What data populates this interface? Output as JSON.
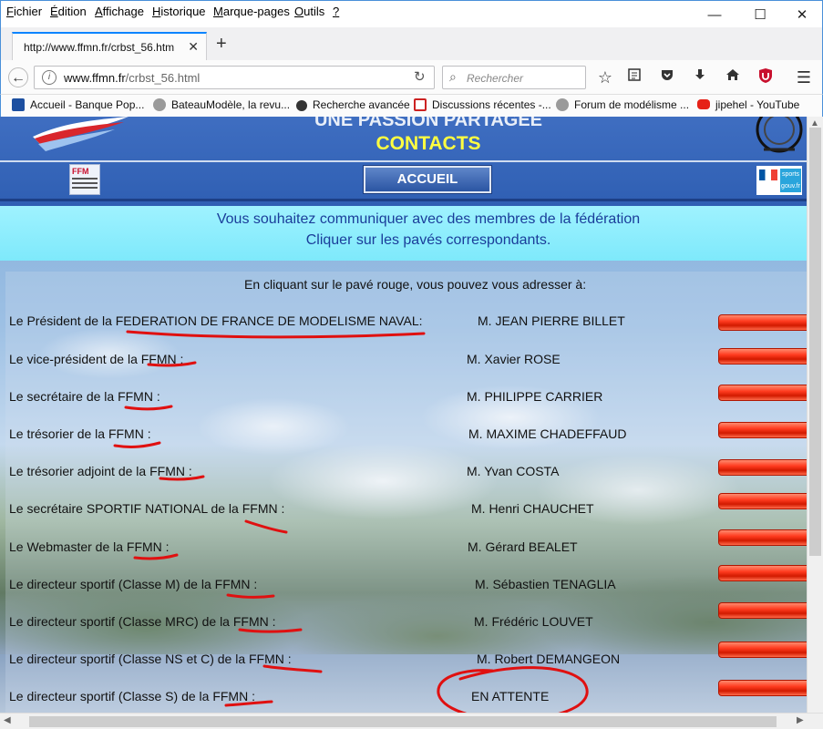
{
  "menubar": {
    "items": [
      "Fichier",
      "Édition",
      "Affichage",
      "Historique",
      "Marque-pages",
      "Outils",
      "?"
    ],
    "underlined": [
      "F",
      "É",
      "A",
      "H",
      "M",
      "O",
      "?"
    ],
    "rest": [
      "ichier",
      "dition",
      "ffichage",
      "istorique",
      "arque-pages",
      "utils",
      ""
    ]
  },
  "window_controls": {
    "minimize": "—",
    "maximize": "☐",
    "close": "✕"
  },
  "tab": {
    "title": "http://www.ffmn.fr/crbst_56.htm",
    "close": "✕",
    "new_tab": "+"
  },
  "navbar": {
    "url_domain": "www.ffmn.fr",
    "url_path": "/crbst_56.html",
    "search_placeholder": "Rechercher",
    "back": "←",
    "reload": "↻",
    "star": "☆",
    "menu": "☰"
  },
  "bookmarks": [
    {
      "label": "Accueil - Banque Pop...",
      "icon": "bank-icon",
      "color": "#1c4fa0"
    },
    {
      "label": "BateauModèle, la revu...",
      "icon": "globe-icon",
      "color": "#777777"
    },
    {
      "label": "Recherche avancée",
      "icon": "wheel-icon",
      "color": "#333333"
    },
    {
      "label": "Discussions récentes -...",
      "icon": "forum-icon",
      "color": "#cc2222"
    },
    {
      "label": "Forum de modélisme ...",
      "icon": "globe-icon",
      "color": "#777777"
    },
    {
      "label": "jipehel - YouTube",
      "icon": "youtube-icon",
      "color": "#e62117"
    }
  ],
  "header": {
    "slogan": "UNE PASSION PARTAGEE",
    "section_title": "CONTACTS",
    "home_button": "ACCUEIL",
    "ffm_logo_text": "FFM",
    "gov_sports": "sports gouv.fr"
  },
  "intro": {
    "line1": "Vous  souhaitez communiquer avec des membres de la fédération",
    "line2": "Cliquer sur les pavés correspondants."
  },
  "contacts_note": "En cliquant sur le pavé rouge, vous pouvez vous adresser à:",
  "contacts": [
    {
      "role": "Le Président de la FEDERATION DE FRANCE DE MODELISME NAVAL:",
      "name": "M. JEAN PIERRE BILLET"
    },
    {
      "role": "Le vice-président de la FFMN :",
      "name": "M. Xavier ROSE"
    },
    {
      "role": "Le secrétaire de la FFMN :",
      "name": "M. PHILIPPE CARRIER"
    },
    {
      "role": "Le trésorier de la FFMN :",
      "name": "M. MAXIME CHADEFFAUD"
    },
    {
      "role": "Le trésorier adjoint de la FFMN :",
      "name": "M. Yvan COSTA"
    },
    {
      "role": "Le secrétaire SPORTIF NATIONAL de la FFMN :",
      "name": "M. Henri CHAUCHET"
    },
    {
      "role": "Le Webmaster de la FFMN :",
      "name": "M. Gérard BEALET"
    },
    {
      "role": "Le directeur sportif (Classe M) de la FFMN :",
      "name": "M. Sébastien TENAGLIA"
    },
    {
      "role": "Le directeur sportif (Classe MRC) de la FFMN :",
      "name": "M. Frédéric LOUVET"
    },
    {
      "role": "Le directeur sportif (Classe NS et C) de la FFMN :",
      "name": "M. Robert DEMANGEON"
    },
    {
      "role": "Le directeur sportif (Classe S) de la FFMN :",
      "name": "EN ATTENTE"
    }
  ],
  "colors": {
    "accent_tab": "#0a84ff",
    "header_blue": "#3f6ec1",
    "title_yellow": "#ffff40",
    "intro_cyan": "#9ff2ff",
    "contact_button_red": "#ff3b1f",
    "annotation_red": "#e01010"
  }
}
